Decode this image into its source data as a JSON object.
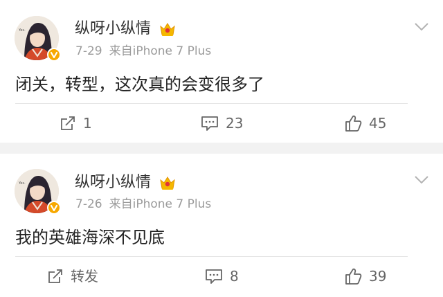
{
  "posts": [
    {
      "username": "纵呀小纵情",
      "date": "7-29",
      "source": "来自iPhone 7 Plus",
      "text": "闭关，转型，这次真的会变很多了",
      "actions": {
        "repost": "1",
        "comment": "23",
        "like": "45"
      }
    },
    {
      "username": "纵呀小纵情",
      "date": "7-26",
      "source": "来自iPhone 7 Plus",
      "text": "我的英雄海深不见底",
      "actions": {
        "repost": "转发",
        "comment": "8",
        "like": "39"
      }
    }
  ],
  "icons": {
    "avatar": "anime-girl-avatar",
    "verified": "verified-badge-icon",
    "crown": "vip-crown-icon",
    "menu": "chevron-down-icon",
    "repost": "repost-icon",
    "comment": "comment-icon",
    "like": "thumbs-up-icon"
  },
  "colors": {
    "background": "#f2f2f2",
    "card": "#ffffff",
    "text": "#222222",
    "meta": "#9b9b9b",
    "verified": "#f7a800",
    "crown": "#f5b800"
  }
}
